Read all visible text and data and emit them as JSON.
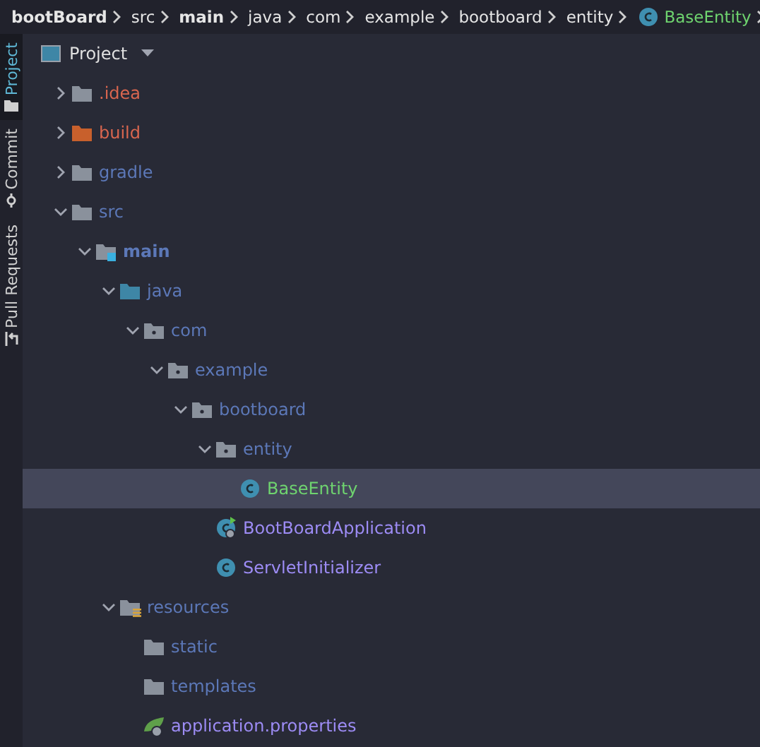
{
  "breadcrumbs": [
    {
      "label": "bootBoard",
      "kind": "module"
    },
    {
      "label": "src",
      "kind": "folder"
    },
    {
      "label": "main",
      "kind": "module"
    },
    {
      "label": "java",
      "kind": "folder"
    },
    {
      "label": "com",
      "kind": "folder"
    },
    {
      "label": "example",
      "kind": "folder"
    },
    {
      "label": "bootboard",
      "kind": "folder"
    },
    {
      "label": "entity",
      "kind": "folder"
    },
    {
      "label": "BaseEntity",
      "kind": "class"
    }
  ],
  "tool_strip": [
    {
      "label": "Project",
      "selected": true,
      "kind": "project"
    },
    {
      "label": "Commit",
      "selected": false,
      "kind": "commit"
    },
    {
      "label": "Pull Requests",
      "selected": false,
      "kind": "pull"
    }
  ],
  "panel": {
    "title": "Project"
  },
  "tree": [
    {
      "name": ".idea",
      "kind": "folder",
      "color": "#d9664f",
      "expanded": false,
      "selected": false
    },
    {
      "name": "build",
      "kind": "excluded",
      "color": "#d9664f",
      "expanded": false,
      "selected": false
    },
    {
      "name": "gradle",
      "kind": "folder",
      "color": "#5c78b8",
      "expanded": false,
      "selected": false
    },
    {
      "name": "src",
      "kind": "folder",
      "color": "#5c78b8",
      "expanded": true,
      "selected": false,
      "children": [
        {
          "name": "main",
          "kind": "module",
          "color": "#5c78b8",
          "expanded": true,
          "selected": false,
          "children": [
            {
              "name": "java",
              "kind": "source",
              "color": "#5c78b8",
              "expanded": true,
              "selected": false,
              "children": [
                {
                  "name": "com",
                  "kind": "package",
                  "color": "#5c78b8",
                  "expanded": true,
                  "selected": false,
                  "children": [
                    {
                      "name": "example",
                      "kind": "package",
                      "color": "#5c78b8",
                      "expanded": true,
                      "selected": false,
                      "children": [
                        {
                          "name": "bootboard",
                          "kind": "package",
                          "color": "#5c78b8",
                          "expanded": true,
                          "selected": false,
                          "children": [
                            {
                              "name": "entity",
                              "kind": "package",
                              "color": "#5c78b8",
                              "expanded": true,
                              "selected": false,
                              "children": [
                                {
                                  "name": "BaseEntity",
                                  "kind": "class",
                                  "color": "#6fd46f",
                                  "selected": true
                                }
                              ]
                            },
                            {
                              "name": "BootBoardApplication",
                              "kind": "app",
                              "color": "#9d8cf5",
                              "selected": false
                            },
                            {
                              "name": "ServletInitializer",
                              "kind": "class",
                              "color": "#9d8cf5",
                              "selected": false
                            }
                          ]
                        }
                      ]
                    }
                  ]
                }
              ]
            },
            {
              "name": "resources",
              "kind": "resources",
              "color": "#5c78b8",
              "expanded": true,
              "selected": false,
              "children": [
                {
                  "name": "static",
                  "kind": "folder",
                  "color": "#5c78b8",
                  "selected": false
                },
                {
                  "name": "templates",
                  "kind": "folder",
                  "color": "#5c78b8",
                  "selected": false
                },
                {
                  "name": "application.properties",
                  "kind": "properties",
                  "color": "#9d8cf5",
                  "selected": false
                }
              ]
            }
          ]
        }
      ]
    }
  ]
}
